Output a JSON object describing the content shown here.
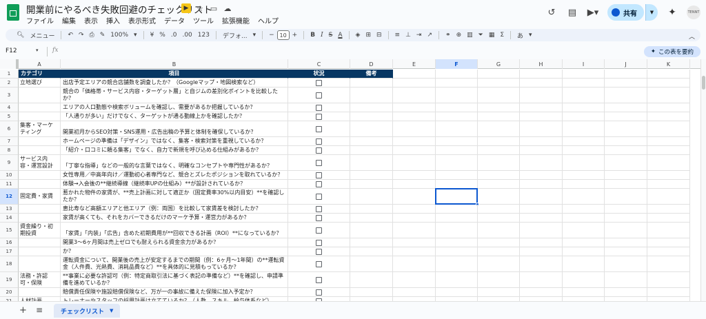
{
  "app": {
    "title": "開業前にやるべき失敗回避のチェックリスト",
    "menu": [
      "ファイル",
      "編集",
      "表示",
      "挿入",
      "表示形式",
      "データ",
      "ツール",
      "拡張機能",
      "ヘルプ"
    ],
    "share_label": "共有",
    "avatar_text": "TENNT"
  },
  "toolbar": {
    "search_label": "メニュー",
    "zoom": "100%",
    "currency": "¥",
    "percent": "%",
    "decrease_decimal": ".0",
    "increase_decimal": ".00",
    "number_format": "123",
    "font_name": "デフォ...",
    "font_size": "10",
    "minus": "−",
    "plus": "+",
    "bold": "B",
    "italic": "I",
    "strike": "S",
    "text_color": "A",
    "input_tools": "あ"
  },
  "formula_bar": {
    "cell_ref": "F12",
    "fx": "fx",
    "summarize_label": "この表を要約"
  },
  "columns": [
    "A",
    "B",
    "C",
    "D",
    "E",
    "F",
    "G",
    "H",
    "I",
    "J",
    "K"
  ],
  "selected_column": "F",
  "selected_row": "12",
  "header_row": {
    "category": "カテゴリ",
    "item": "項目",
    "status": "状況",
    "note": "備考"
  },
  "rows": [
    {
      "n": "1"
    },
    {
      "n": "2",
      "cat": "立地選び",
      "item": "出店予定エリアの競合店舗数を調査したか？（Googleマップ・地図検索など）"
    },
    {
      "n": "3",
      "cat": "",
      "item": "競合の「価格帯・サービス内容・ターゲット層」と自ジムの差別化ポイントを比較したか？"
    },
    {
      "n": "4",
      "cat": "",
      "item": "エリアの人口動態や検索ボリュームを確認し、需要があるか把握しているか？"
    },
    {
      "n": "5",
      "cat": "",
      "item": "「人通りが多い」だけでなく、ターゲットが通る動線上かを確認したか？"
    },
    {
      "n": "6",
      "cat": "集客・マーケティング",
      "item": "開業初月からSEO対策・SNS運用・広告出稿の予算と体制を確保しているか？"
    },
    {
      "n": "7",
      "cat": "",
      "item": "ホームページの準備は「デザイン」ではなく、集客・検索対策を重視しているか？"
    },
    {
      "n": "8",
      "cat": "",
      "item": "「紹介・口コミに頼る集客」でなく、自力で新規を呼び込める仕組みがあるか？"
    },
    {
      "n": "9",
      "cat": "サービス内容・運営設計",
      "item": "「丁寧な指導」などの一般的な言葉ではなく、明確なコンセプトや専門性があるか？"
    },
    {
      "n": "10",
      "cat": "",
      "item": "女性専用／中高年向け／運動初心者専門など、競合とズレたポジションを取れているか？"
    },
    {
      "n": "11",
      "cat": "",
      "item": "体験→入会後の**継続導線（継続率UPの仕組み）**が設計されているか？"
    },
    {
      "n": "12",
      "cat": "固定費・家賃",
      "item": "惹かれた物件の家賃が、**売上計画に対して適正か（固定費率30%以内目安）**を確認したか？"
    },
    {
      "n": "13",
      "cat": "",
      "item": "恵比寿など高額エリアと他エリア（例：両国）を比較して家賃差を検討したか？"
    },
    {
      "n": "14",
      "cat": "",
      "item": "家賃が高くても、それをカバーできるだけのマーケ予算・運営力があるか？"
    },
    {
      "n": "15",
      "cat": "資金繰り・初期投資",
      "item": "「家賃」「内装」「広告」含めた初期費用が**回収できる計画（ROI）**になっているか？"
    },
    {
      "n": "16",
      "cat": "",
      "item": "開業3〜6ヶ月間は売上ゼロでも耐えられる資金余力があるか？"
    },
    {
      "n": "17",
      "cat": "",
      "item": "広告費や人件費を**最後に削る**のではなく、最初から組み込んで**資金計画を立てたか？"
    },
    {
      "n": "18",
      "cat": "",
      "item": "運転資金について、開業後の売上が安定するまでの期間（例：6ヶ月〜1年間）の**運転資金（人件費、光熱費、消耗品費など）**を具体的に見積もっているか？"
    },
    {
      "n": "19",
      "cat": "法務・許認可・保険",
      "item": "**事業に必要な許認可（例：特定商取引法に基づく表記の準備など）**を確認し、申請準備を進めているか？"
    },
    {
      "n": "20",
      "cat": "",
      "item": "賠償責任保険や施設賠償保険など、万が一の事故に備えた保険に加入予定か？"
    },
    {
      "n": "21",
      "cat": "人材計画",
      "item": "トレーナーやスタッフの採用計画は立てているか？（人数、スキル、給与体系など）"
    }
  ],
  "sheet_tab": "チェックリスト"
}
